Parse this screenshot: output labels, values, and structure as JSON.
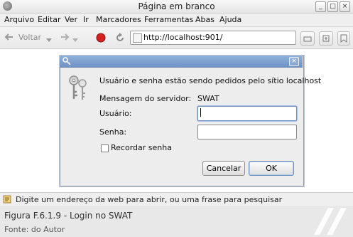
{
  "window": {
    "title": "Página em branco"
  },
  "menubar": {
    "items": [
      {
        "label": "Arquivo"
      },
      {
        "label": "Editar"
      },
      {
        "label": "Ver"
      },
      {
        "label": "Ir"
      },
      {
        "label": "Marcadores"
      },
      {
        "label": "Ferramentas"
      },
      {
        "label": "Abas"
      },
      {
        "label": "Ajuda"
      }
    ]
  },
  "toolbar": {
    "back_label": "Voltar",
    "url": "http://localhost:901/"
  },
  "dialog": {
    "message": "Usuário e senha estão sendo pedidos pelo sítio localhost",
    "server_message_label": "Mensagem do servidor:",
    "server_message_value": "SWAT",
    "username_label": "Usuário:",
    "username_value": "",
    "password_label": "Senha:",
    "password_value": "",
    "remember_label": "Recordar senha",
    "remember_checked": false,
    "cancel_label": "Cancelar",
    "ok_label": "OK"
  },
  "statusbar": {
    "text": "Digite um endereço da web para abrir, ou uma frase para pesquisar"
  },
  "caption": {
    "title": "Figura F.6.1.9 - Login no SWAT",
    "source": "Fonte: do Autor"
  }
}
